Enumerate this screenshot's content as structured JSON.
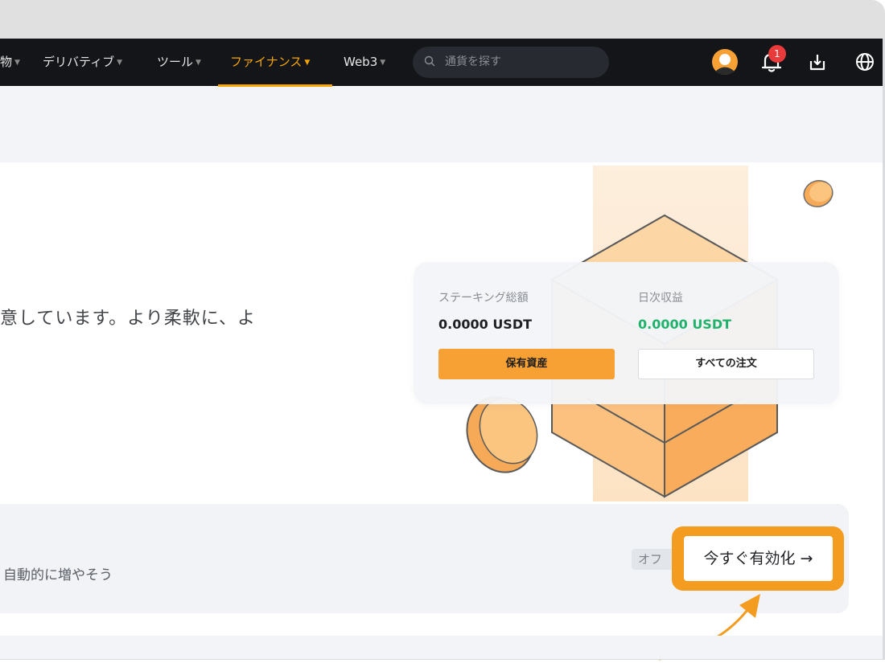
{
  "navbar": {
    "items": [
      {
        "label": "物"
      },
      {
        "label": "デリバティブ"
      },
      {
        "label": "ツール"
      },
      {
        "label": "ファイナンス",
        "active": true
      },
      {
        "label": "Web3"
      }
    ],
    "search_placeholder": "通貨を探す",
    "notification_count": "1",
    "accent_color": "#f7a600",
    "icons": [
      "avatar-icon",
      "bell-icon",
      "download-icon",
      "globe-icon"
    ]
  },
  "hero": {
    "text": "意しています。より柔軟に、よ"
  },
  "stats": {
    "total_label": "ステーキング総額",
    "total_value": "0.0000 USDT",
    "daily_label": "日次収益",
    "daily_value": "0.0000 USDT",
    "daily_color": "#20b26c",
    "holdings_button": "保有資産",
    "orders_button": "すべての注文"
  },
  "auto": {
    "description": "自動的に増やそう",
    "status": "オフ",
    "cta": "今すぐ有効化 →"
  }
}
